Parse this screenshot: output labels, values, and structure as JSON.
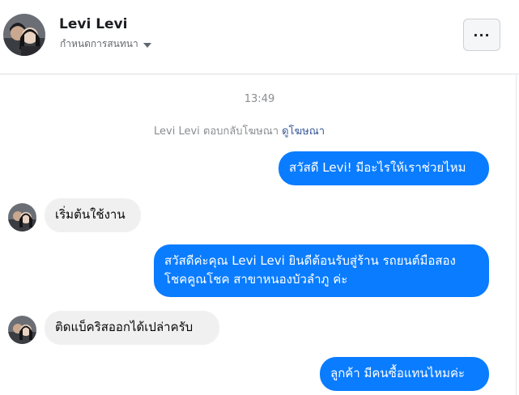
{
  "header": {
    "name": "Levi Levi",
    "subtitle": "กำหนดการสนทนา",
    "more_label": "···"
  },
  "conversation": {
    "timestamp": "13:49",
    "system_note": "Levi Levi ตอบกลับโฆษณา",
    "system_link": "ดูโฆษณา",
    "messages": [
      {
        "sender": "page",
        "text": "สวัสดี Levi! มีอะไรให้เราช่วยไหม"
      },
      {
        "sender": "user",
        "text": "เริ่มต้นใช้งาน"
      },
      {
        "sender": "page",
        "text": "สวัสดีค่ะคุณ Levi Levi ยินดีต้อนรับสู่ร้าน รถยนต์มือสอง โชคคูณโชค สาขาหนองบัวลำภู ค่ะ"
      },
      {
        "sender": "user",
        "text": "ติดแบ็คริสออกได้เปล่าครับ"
      },
      {
        "sender": "page",
        "text": "ลูกค้า มีคนซื้อแทนไหมค่ะ"
      }
    ]
  },
  "colors": {
    "outgoing_bubble": "#0a7cff",
    "incoming_bubble": "#f0f0f0",
    "link": "#385898",
    "muted_text": "#8a8d91"
  }
}
